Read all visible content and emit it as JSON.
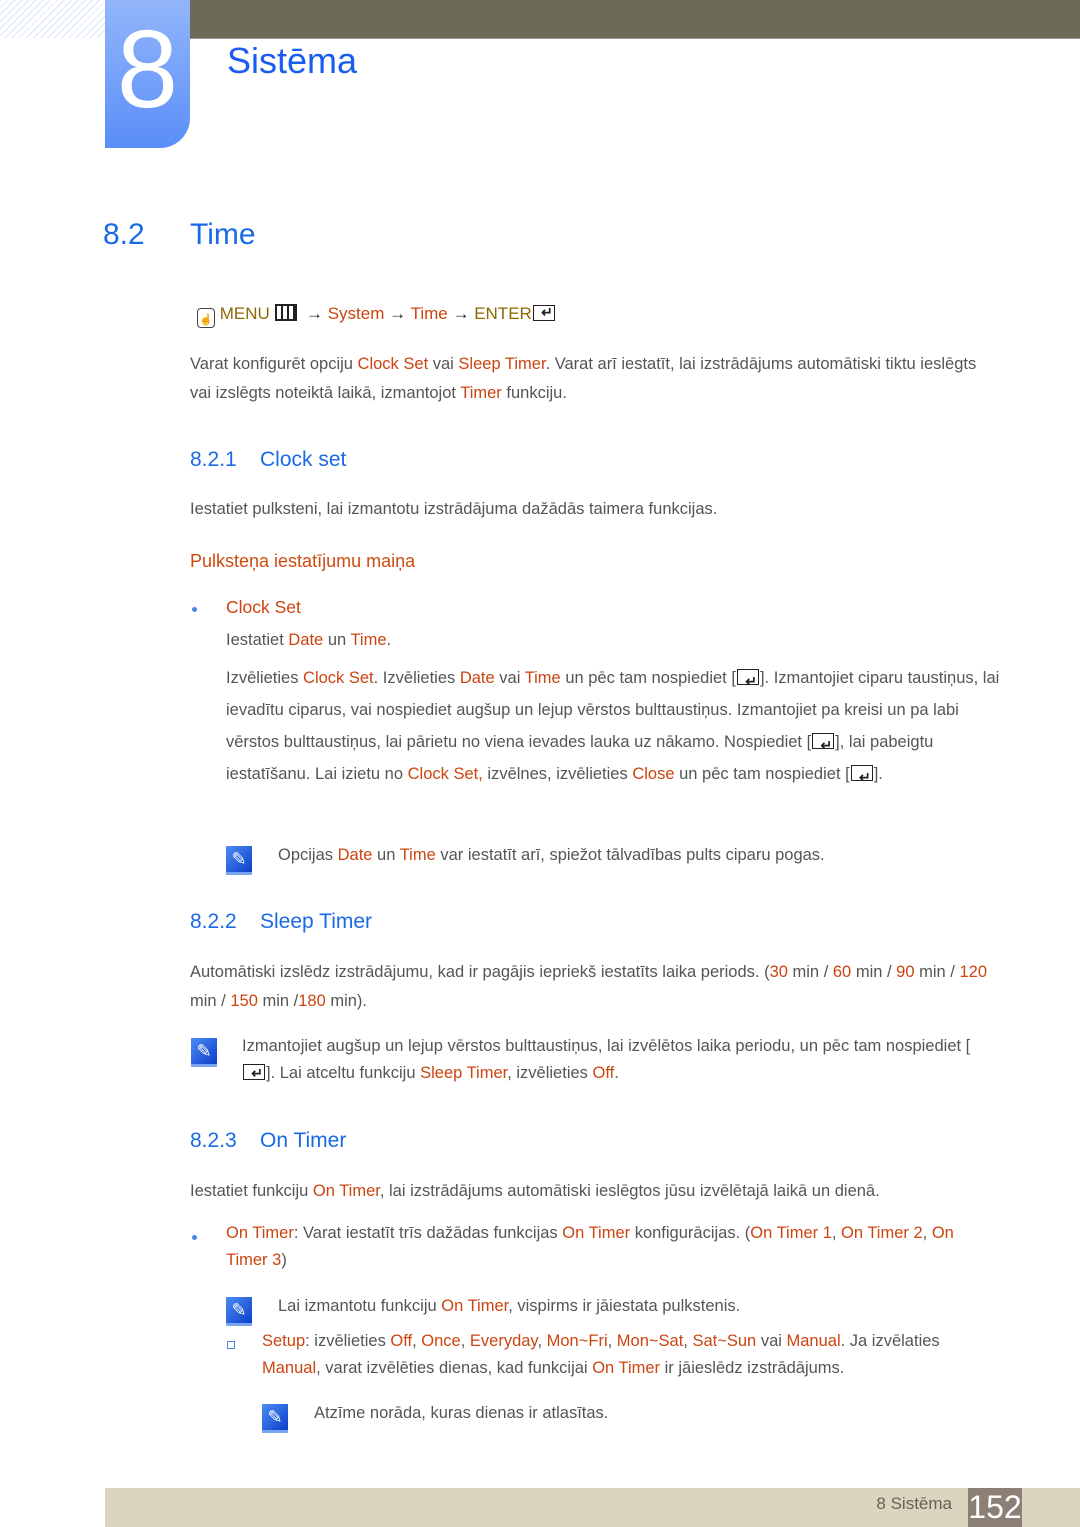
{
  "chapter": {
    "number": "8",
    "title": "Sistēma"
  },
  "section": {
    "number": "8.2",
    "title": "Time"
  },
  "menu_path": {
    "menu": "MENU",
    "arrow": "→",
    "system": "System",
    "time": "Time",
    "enter": "ENTER"
  },
  "intro": [
    {
      "t": "Varat konfigurēt opciju "
    },
    {
      "t": "Clock Set",
      "h": 1
    },
    {
      "t": " vai "
    },
    {
      "t": "Sleep Timer",
      "h": 1
    },
    {
      "t": ". Varat arī iestatīt, lai izstrādājums automātiski tiktu ieslēgts vai izslēgts noteiktā laikā, izmantojot "
    },
    {
      "t": "Timer",
      "h": 1
    },
    {
      "t": " funkciju."
    }
  ],
  "s821": {
    "number": "8.2.1",
    "title": "Clock set",
    "text": "Iestatiet pulksteni, lai izmantotu izstrādājuma dažādās taimera funkcijas.",
    "subheading": "Pulksteņa iestatījumu maiņa",
    "bullet_title": "Clock Set",
    "line1": [
      {
        "t": "Iestatiet "
      },
      {
        "t": "Date",
        "h": 1
      },
      {
        "t": " un "
      },
      {
        "t": "Time",
        "h": 1
      },
      {
        "t": "."
      }
    ],
    "para": [
      {
        "t": "Izvēlieties "
      },
      {
        "t": "Clock Set",
        "h": 1
      },
      {
        "t": ". Izvēlieties "
      },
      {
        "t": "Date",
        "h": 1
      },
      {
        "t": " vai "
      },
      {
        "t": "Time",
        "h": 1
      },
      {
        "t": " un pēc tam nospiediet ["
      },
      {
        "icon": "enter"
      },
      {
        "t": "]. Izmantojiet ciparu taustiņus, lai ievadītu ciparus, vai nospiediet augšup un lejup vērstos bulttaustiņus. Izmantojiet pa kreisi un pa labi vērstos bulttaustiņus, lai pārietu no viena ievades lauka uz nākamo. Nospiediet ["
      },
      {
        "icon": "enter"
      },
      {
        "t": "], lai pabeigtu iestatīšanu. Lai izietu no "
      },
      {
        "t": "Clock Set,",
        "h": 1
      },
      {
        "t": " izvēlnes, izvēlieties "
      },
      {
        "t": "Close",
        "h": 1
      },
      {
        "t": " un pēc tam nospiediet ["
      },
      {
        "icon": "enter"
      },
      {
        "t": "]."
      }
    ],
    "note": [
      {
        "t": "Opcijas "
      },
      {
        "t": "Date",
        "h": 1
      },
      {
        "t": " un "
      },
      {
        "t": "Time",
        "h": 1
      },
      {
        "t": " var iestatīt arī, spiežot tālvadības pults ciparu pogas."
      }
    ]
  },
  "s822": {
    "number": "8.2.2",
    "title": "Sleep Timer",
    "text": [
      {
        "t": "Automātiski izslēdz izstrādājumu, kad ir pagājis iepriekš iestatīts laika periods. ("
      },
      {
        "t": "30",
        "h": 1
      },
      {
        "t": " min / "
      },
      {
        "t": "60",
        "h": 1
      },
      {
        "t": " min / "
      },
      {
        "t": "90",
        "h": 1
      },
      {
        "t": " min / "
      },
      {
        "t": "120",
        "h": 1
      },
      {
        "t": " min / "
      },
      {
        "t": "150",
        "h": 1
      },
      {
        "t": " min /"
      },
      {
        "t": "180",
        "h": 1
      },
      {
        "t": " min)."
      }
    ],
    "note": [
      {
        "t": "Izmantojiet augšup un lejup vērstos bulttaustiņus, lai izvēlētos laika periodu, un pēc tam nospiediet ["
      },
      {
        "icon": "enter"
      },
      {
        "t": "]. Lai atceltu funkciju "
      },
      {
        "t": "Sleep Timer",
        "h": 1
      },
      {
        "t": ", izvēlieties "
      },
      {
        "t": "Off",
        "h": 1
      },
      {
        "t": "."
      }
    ]
  },
  "s823": {
    "number": "8.2.3",
    "title": "On Timer",
    "text": [
      {
        "t": "Iestatiet funkciju "
      },
      {
        "t": "On Timer",
        "h": 1
      },
      {
        "t": ", lai izstrādājums automātiski ieslēgtos jūsu izvēlētajā laikā un dienā."
      }
    ],
    "bullet": [
      {
        "t": "On Timer",
        "h": 1
      },
      {
        "t": ": Varat iestatīt trīs dažādas funkcijas "
      },
      {
        "t": "On Timer",
        "h": 1
      },
      {
        "t": " konfigurācijas. ("
      },
      {
        "t": "On Timer 1",
        "h": 1
      },
      {
        "t": ", "
      },
      {
        "t": "On Timer 2",
        "h": 1
      },
      {
        "t": ", "
      },
      {
        "t": "On Timer 3",
        "h": 1
      },
      {
        "t": ")"
      }
    ],
    "note": [
      {
        "t": "Lai izmantotu funkciju "
      },
      {
        "t": "On Timer",
        "h": 1
      },
      {
        "t": ", vispirms ir jāiestata pulkstenis."
      }
    ],
    "setup": [
      {
        "t": "Setup",
        "h": 1
      },
      {
        "t": ": izvēlieties "
      },
      {
        "t": "Off",
        "h": 1
      },
      {
        "t": ", "
      },
      {
        "t": "Once",
        "h": 1
      },
      {
        "t": ", "
      },
      {
        "t": "Everyday",
        "h": 1
      },
      {
        "t": ", "
      },
      {
        "t": "Mon~Fri",
        "h": 1
      },
      {
        "t": ", "
      },
      {
        "t": "Mon~Sat",
        "h": 1
      },
      {
        "t": ", "
      },
      {
        "t": "Sat~Sun",
        "h": 1
      },
      {
        "t": " vai "
      },
      {
        "t": "Manual",
        "h": 1
      },
      {
        "t": ". Ja izvēlaties "
      },
      {
        "t": "Manual",
        "h": 1
      },
      {
        "t": ", varat izvēlēties dienas, kad funkcijai "
      },
      {
        "t": "On Timer",
        "h": 1
      },
      {
        "t": " ir jāieslēdz izstrādājums."
      }
    ],
    "subnote": "Atzīme norāda, kuras dienas ir atlasītas."
  },
  "footer": {
    "chapter": "8 Sistēma",
    "page": "152"
  },
  "colors": {
    "highlight": "#cc4410",
    "heading": "#1a6ae8",
    "menu": "#8a6a00"
  },
  "icons": {
    "note": "note-pen-icon",
    "enter": "enter-key-icon",
    "menu": "menu-icon",
    "remote": "remote-hand-icon"
  }
}
